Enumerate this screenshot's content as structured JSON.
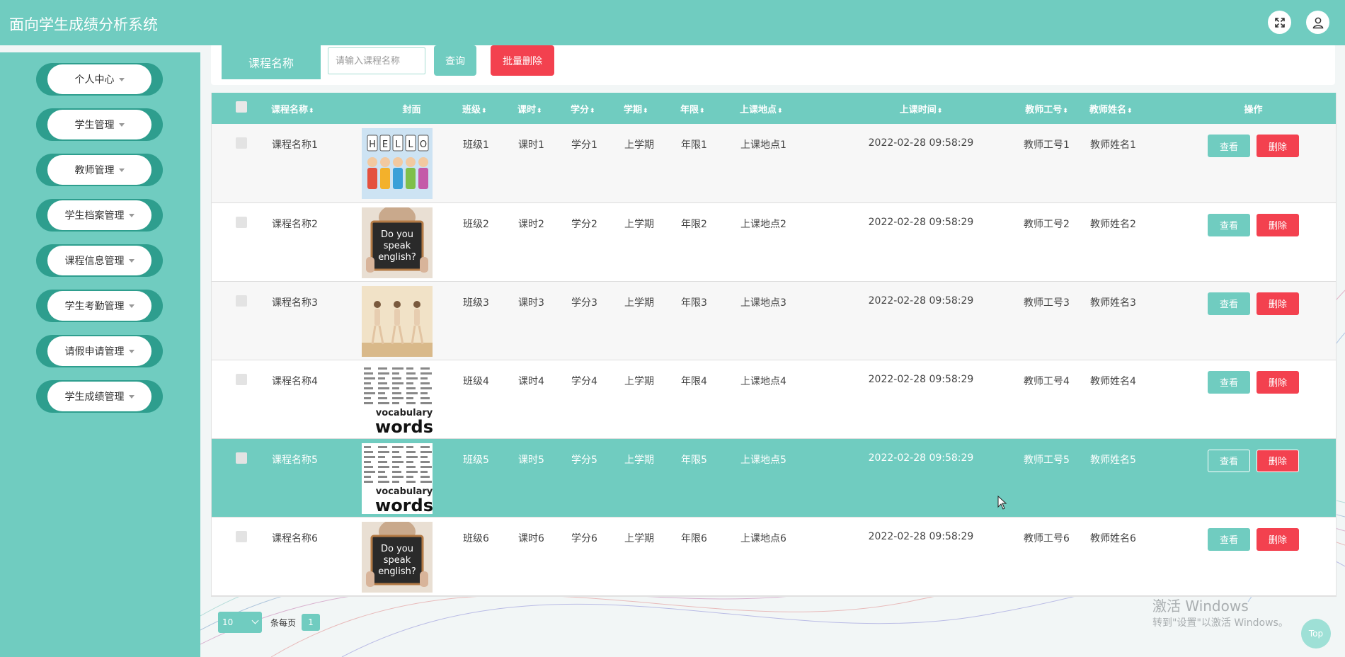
{
  "app": {
    "title": "面向学生成绩分析系统"
  },
  "header": {
    "fullscreen_icon": "fullscreen-icon",
    "user_icon": "user-icon"
  },
  "sidebar": {
    "items": [
      {
        "label": "个人中心"
      },
      {
        "label": "学生管理"
      },
      {
        "label": "教师管理"
      },
      {
        "label": "学生档案管理"
      },
      {
        "label": "课程信息管理"
      },
      {
        "label": "学生考勤管理"
      },
      {
        "label": "请假申请管理"
      },
      {
        "label": "学生成绩管理"
      }
    ]
  },
  "search": {
    "label": "课程名称",
    "placeholder": "请输入课程名称",
    "value": "",
    "query_button": "查询",
    "batch_delete_button": "批量删除"
  },
  "table": {
    "columns": [
      {
        "label": "课程名称",
        "sortable": true
      },
      {
        "label": "封面",
        "sortable": false
      },
      {
        "label": "班级",
        "sortable": true
      },
      {
        "label": "课时",
        "sortable": true
      },
      {
        "label": "学分",
        "sortable": true
      },
      {
        "label": "学期",
        "sortable": true
      },
      {
        "label": "年限",
        "sortable": true
      },
      {
        "label": "上课地点",
        "sortable": true
      },
      {
        "label": "上课时间",
        "sortable": true
      },
      {
        "label": "教师工号",
        "sortable": true
      },
      {
        "label": "教师姓名",
        "sortable": true
      },
      {
        "label": "操作",
        "sortable": false
      }
    ],
    "sort_glyph": "⬍",
    "rows": [
      {
        "name": "课程名称1",
        "cover": "hello-kids",
        "class": "班级1",
        "hours": "课时1",
        "credit": "学分1",
        "term": "上学期",
        "years": "年限1",
        "place": "上课地点1",
        "time": "2022-02-28 09:58:29",
        "teacher_id": "教师工号1",
        "teacher_name": "教师姓名1",
        "view": "查看",
        "delete": "删除"
      },
      {
        "name": "课程名称2",
        "cover": "speak-english",
        "class": "班级2",
        "hours": "课时2",
        "credit": "学分2",
        "term": "上学期",
        "years": "年限2",
        "place": "上课地点2",
        "time": "2022-02-28 09:58:29",
        "teacher_id": "教师工号2",
        "teacher_name": "教师姓名2",
        "view": "查看",
        "delete": "删除"
      },
      {
        "name": "课程名称3",
        "cover": "dancers",
        "class": "班级3",
        "hours": "课时3",
        "credit": "学分3",
        "term": "上学期",
        "years": "年限3",
        "place": "上课地点3",
        "time": "2022-02-28 09:58:29",
        "teacher_id": "教师工号3",
        "teacher_name": "教师姓名3",
        "view": "查看",
        "delete": "删除"
      },
      {
        "name": "课程名称4",
        "cover": "vocabulary-words",
        "class": "班级4",
        "hours": "课时4",
        "credit": "学分4",
        "term": "上学期",
        "years": "年限4",
        "place": "上课地点4",
        "time": "2022-02-28 09:58:29",
        "teacher_id": "教师工号4",
        "teacher_name": "教师姓名4",
        "view": "查看",
        "delete": "删除"
      },
      {
        "name": "课程名称5",
        "cover": "vocabulary-words",
        "class": "班级5",
        "hours": "课时5",
        "credit": "学分5",
        "term": "上学期",
        "years": "年限5",
        "place": "上课地点5",
        "time": "2022-02-28 09:58:29",
        "teacher_id": "教师工号5",
        "teacher_name": "教师姓名5",
        "view": "查看",
        "delete": "删除"
      },
      {
        "name": "课程名称6",
        "cover": "speak-english",
        "class": "班级6",
        "hours": "课时6",
        "credit": "学分6",
        "term": "上学期",
        "years": "年限6",
        "place": "上课地点6",
        "time": "2022-02-28 09:58:29",
        "teacher_id": "教师工号6",
        "teacher_name": "教师姓名6",
        "view": "查看",
        "delete": "删除"
      }
    ],
    "highlighted_row": 5
  },
  "pagination": {
    "page_size": "10",
    "per_page_label": "条每页",
    "current_page": "1"
  },
  "cover_text": {
    "hello": "HELLO",
    "speak": [
      "Do you",
      "speak",
      "english?"
    ],
    "vocab": [
      "vocabulary",
      "words"
    ]
  },
  "watermark": {
    "line1": "激活 Windows",
    "line2": "转到\"设置\"以激活 Windows。"
  },
  "scroll_top": {
    "label": "Top"
  },
  "colors": {
    "primary": "#70ccc0",
    "danger": "#f3414f",
    "sidebar_dark": "#2e9e8e"
  }
}
